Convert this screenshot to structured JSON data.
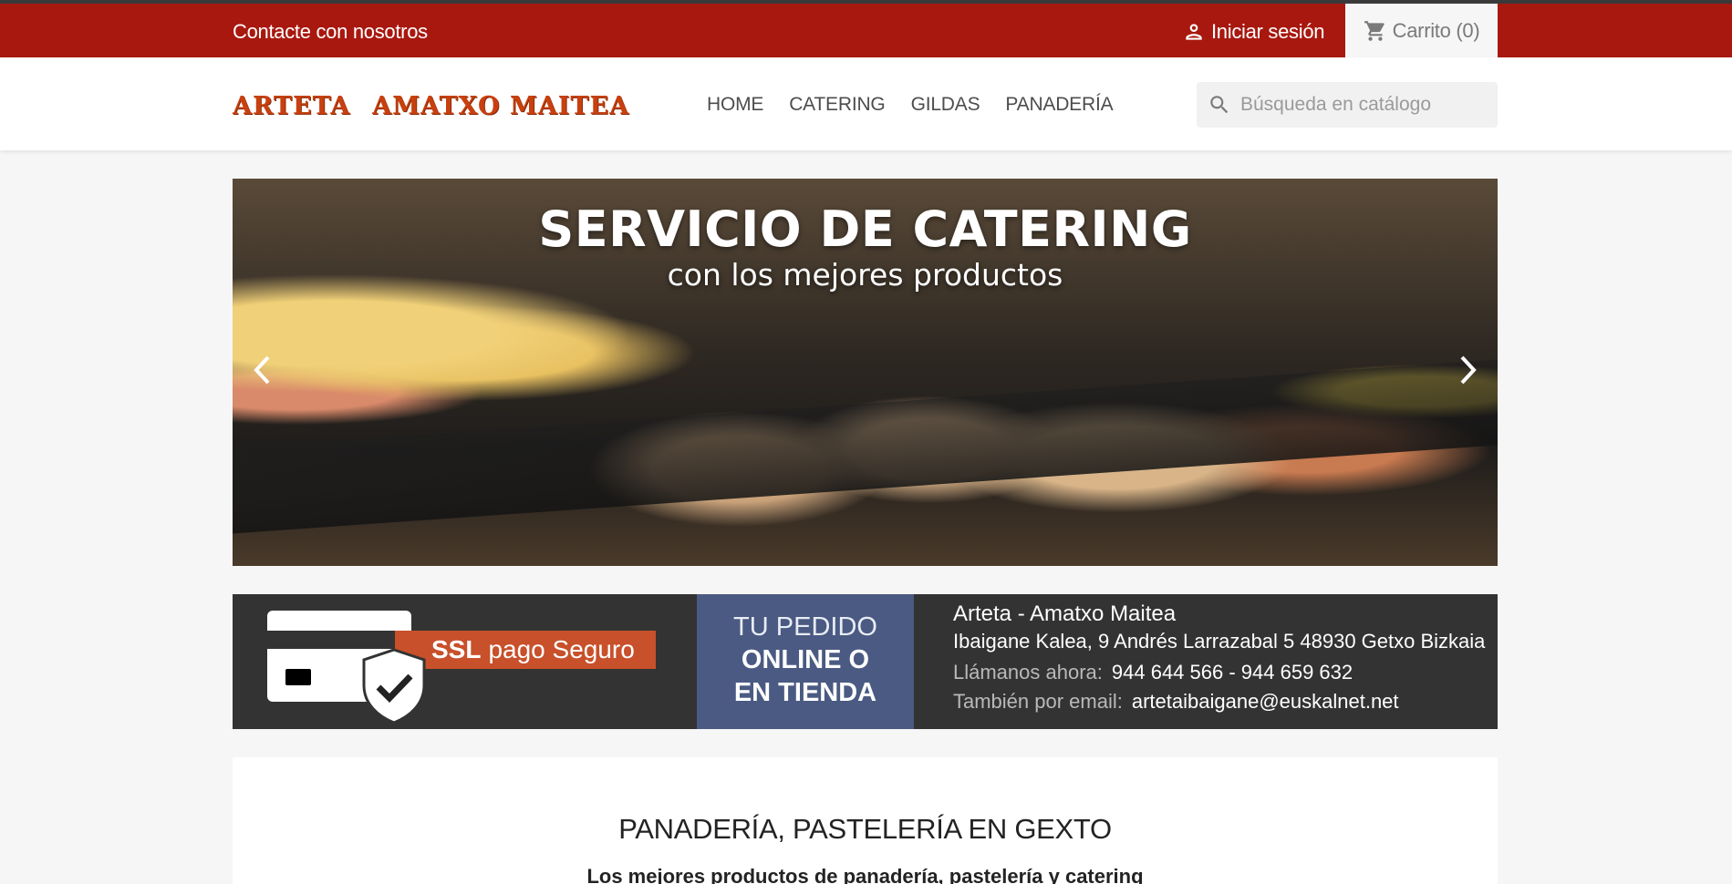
{
  "topbar": {
    "contact": "Contacte con nosotros",
    "login": "Iniciar sesión",
    "cart": "Carrito (0)"
  },
  "header": {
    "logo_left": "ARTETA",
    "logo_right": "AMATXO MAITEA",
    "nav": [
      "HOME",
      "CATERING",
      "GILDAS",
      "PANADERÍA"
    ],
    "search_placeholder": "Búsqueda en catálogo"
  },
  "slider": {
    "title": "SERVICIO DE CATERING",
    "subtitle": "con los mejores productos"
  },
  "info": {
    "ssl_bold": "SSL",
    "ssl_rest": "pago Seguro",
    "order_l1": "TU PEDIDO",
    "order_l2": "ONLINE O",
    "order_l3": "EN TIENDA",
    "name": "Arteta - Amatxo Maitea",
    "address": "Ibaigane Kalea, 9 Andrés Larrazabal 5 48930 Getxo Bizkaia",
    "phone_label": "Llámanos ahora:",
    "phone": "944 644 566 - 944 659 632",
    "email_label": "También por email:",
    "email": "artetaibaigane@euskalnet.net"
  },
  "content": {
    "heading": "PANADERÍA, PASTELERÍA EN GEXTO",
    "subheading": "Los mejores productos de panadería, pastelería y catering"
  },
  "colors": {
    "topbar": "#a8180f",
    "logo": "#c8400f",
    "banner_dark": "#333333",
    "banner_blue": "#4a5a82",
    "ssl_orange": "#c8502a"
  }
}
